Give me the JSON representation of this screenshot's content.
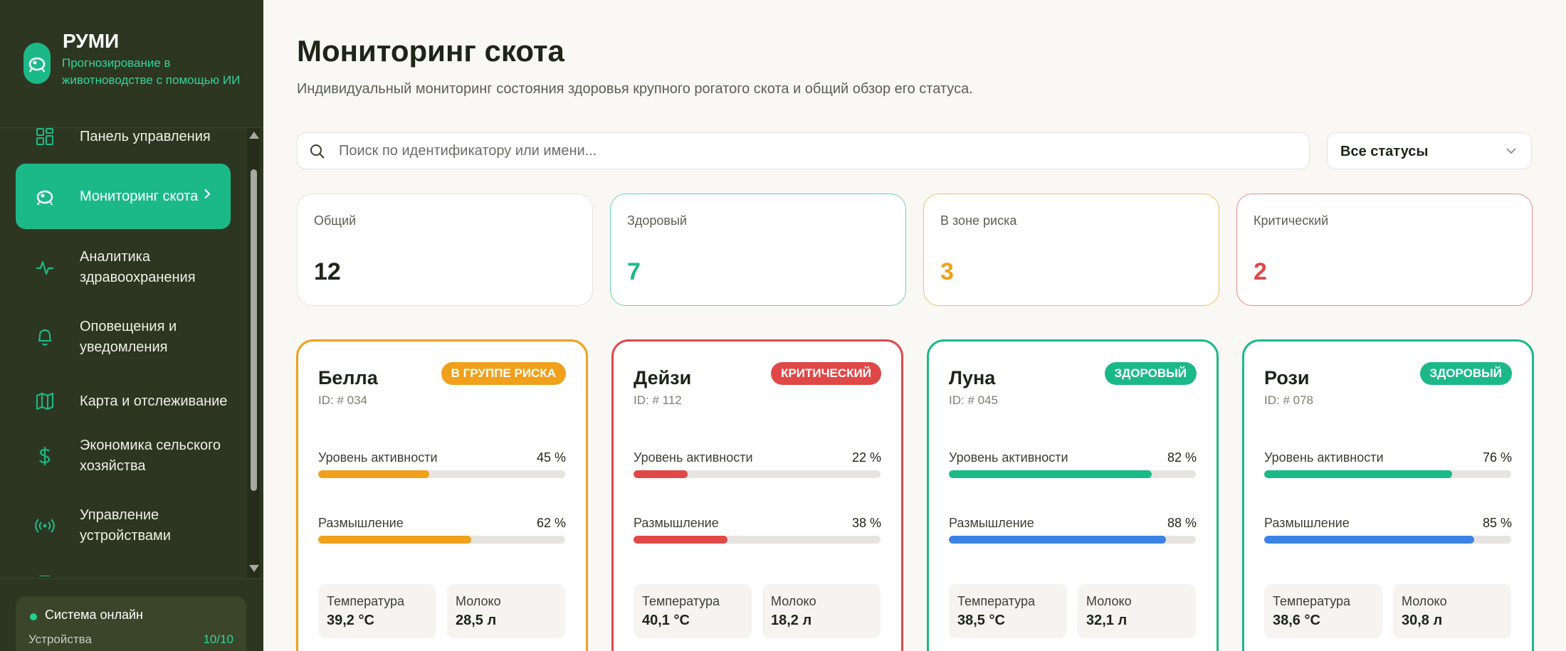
{
  "brand": {
    "title": "РУМИ",
    "subtitle": "Прогнозирование в животноводстве с помощью ИИ"
  },
  "sidebar": {
    "items": [
      {
        "label": "Панель управления",
        "icon": "dashboard-icon"
      },
      {
        "label": "Мониторинг скота",
        "icon": "cattle-icon",
        "active": true
      },
      {
        "label": "Аналитика здравоохранения",
        "icon": "activity-icon"
      },
      {
        "label": "Оповещения и уведомления",
        "icon": "bell-icon"
      },
      {
        "label": "Карта и отслеживание",
        "icon": "map-icon"
      },
      {
        "label": "Экономика сельского хозяйства",
        "icon": "dollar-icon"
      },
      {
        "label": "Управление устройствами",
        "icon": "broadcast-icon"
      }
    ],
    "status": {
      "title": "Система онлайн",
      "devices_label": "Устройства",
      "devices_count": "10/10"
    }
  },
  "page": {
    "title": "Мониторинг скота",
    "subtitle": "Индивидуальный мониторинг состояния здоровья крупного рогатого скота и общий обзор его статуса."
  },
  "search": {
    "placeholder": "Поиск по идентификатору или имени...",
    "value": ""
  },
  "filter": {
    "selected": "Все статусы"
  },
  "stats": [
    {
      "label": "Общий",
      "value": "12",
      "color": "#1f2418",
      "border": "#e4e2dc"
    },
    {
      "label": "Здоровый",
      "value": "7",
      "color": "#1cb988",
      "border": "#67d1b1"
    },
    {
      "label": "В зоне риска",
      "value": "3",
      "color": "#f0a01a",
      "border": "#f0c060"
    },
    {
      "label": "Критический",
      "value": "2",
      "color": "#e04848",
      "border": "#ee8a8a"
    }
  ],
  "labels": {
    "activity": "Уровень активности",
    "rumination": "Размышление",
    "temperature": "Температура",
    "milk": "Молоко"
  },
  "colors": {
    "accent": "#1cb988",
    "risk": "#f0a01a",
    "critical": "#e04848",
    "rumination_healthy": "#3b82e6"
  },
  "animals": [
    {
      "name": "Белла",
      "id": "ID: # 034",
      "badge": "В ГРУППЕ РИСКА",
      "status_color": "#f0a01a",
      "activity": "45 %",
      "activity_value": 45,
      "activity_color": "#f0a01a",
      "rumination": "62 %",
      "rumination_value": 62,
      "rumination_color": "#f0a01a",
      "temperature": "39,2 °C",
      "milk": "28,5 л"
    },
    {
      "name": "Дейзи",
      "id": "ID: # 112",
      "badge": "КРИТИЧЕСКИЙ",
      "status_color": "#e04848",
      "activity": "22 %",
      "activity_value": 22,
      "activity_color": "#e04848",
      "rumination": "38 %",
      "rumination_value": 38,
      "rumination_color": "#e04848",
      "temperature": "40,1 °C",
      "milk": "18,2 л"
    },
    {
      "name": "Луна",
      "id": "ID: # 045",
      "badge": "ЗДОРОВЫЙ",
      "status_color": "#1cb988",
      "activity": "82 %",
      "activity_value": 82,
      "activity_color": "#1cb988",
      "rumination": "88 %",
      "rumination_value": 88,
      "rumination_color": "#3b82e6",
      "temperature": "38,5 °C",
      "milk": "32,1 л"
    },
    {
      "name": "Рози",
      "id": "ID: # 078",
      "badge": "ЗДОРОВЫЙ",
      "status_color": "#1cb988",
      "activity": "76 %",
      "activity_value": 76,
      "activity_color": "#1cb988",
      "rumination": "85 %",
      "rumination_value": 85,
      "rumination_color": "#3b82e6",
      "temperature": "38,6 °C",
      "milk": "30,8 л"
    }
  ]
}
